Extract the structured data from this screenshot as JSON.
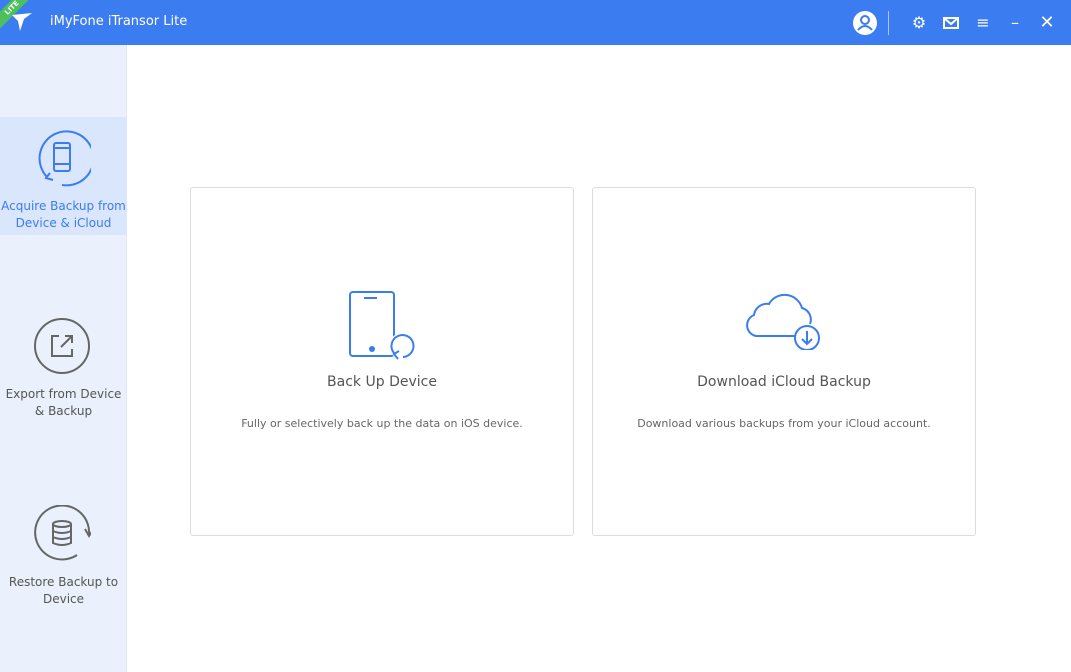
{
  "header": {
    "title": "iMyFone iTransor Lite",
    "badge": "LITE"
  },
  "sidebar": {
    "items": [
      {
        "label": "Acquire Backup from Device & iCloud",
        "active": true
      },
      {
        "label": "Export from Device & Backup",
        "active": false
      },
      {
        "label": "Restore Backup to Device",
        "active": false
      }
    ]
  },
  "cards": [
    {
      "title": "Back Up Device",
      "desc": "Fully or selectively back up the data on iOS device."
    },
    {
      "title": "Download iCloud Backup",
      "desc": "Download various backups from your iCloud account."
    }
  ],
  "colors": {
    "accent": "#3b7cf0",
    "badge": "#4cc05a"
  }
}
